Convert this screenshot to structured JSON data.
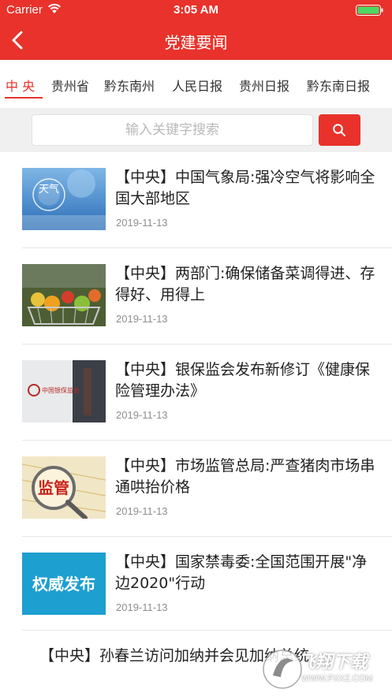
{
  "status_bar": {
    "carrier": "Carrier",
    "time": "3:05 AM"
  },
  "nav": {
    "title": "党建要闻",
    "back_icon": "chevron-left-icon"
  },
  "tabs": [
    {
      "label": "中 央",
      "active": true
    },
    {
      "label": "贵州省",
      "active": false
    },
    {
      "label": "黔东南州",
      "active": false
    },
    {
      "label": "人民日报",
      "active": false
    },
    {
      "label": "贵州日报",
      "active": false
    },
    {
      "label": "黔东南日报",
      "active": false
    }
  ],
  "search": {
    "placeholder": "输入关键字搜索",
    "button_icon": "search-icon"
  },
  "news": [
    {
      "title": "【中央】中国气象局:强冷空气将影响全国大部地区",
      "date": "2019-11-13",
      "thumb_text": "天气"
    },
    {
      "title": "【中央】两部门:确保储备菜调得进、存得好、用得上",
      "date": "2019-11-13",
      "thumb_text": ""
    },
    {
      "title": "【中央】银保监会发布新修订《健康保险管理办法》",
      "date": "2019-11-13",
      "thumb_text": "中国银保监会"
    },
    {
      "title": "【中央】市场监管总局:严查猪肉市场串通哄抬价格",
      "date": "2019-11-13",
      "thumb_text": "监管"
    },
    {
      "title": "【中央】国家禁毒委:全国范围开展\"净边2020\"行动",
      "date": "2019-11-13",
      "thumb_text": "权威发布"
    },
    {
      "title": "【中央】孙春兰访问加纳并会见加纳总统"
    }
  ],
  "watermark": {
    "line1": "飞翔下载",
    "line2": "WWW.FXXZ.COM"
  },
  "colors": {
    "brand_red": "#e8322b",
    "date_gray": "#8e8e8e",
    "divider": "#e6e6e6"
  }
}
